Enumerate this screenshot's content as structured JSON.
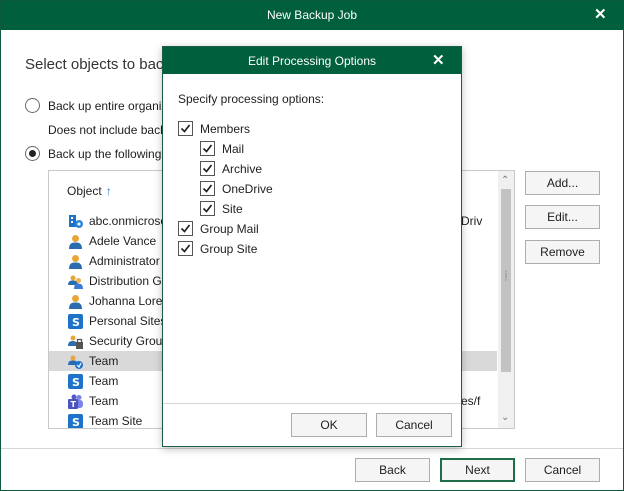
{
  "window": {
    "title": "New Backup Job"
  },
  "main": {
    "heading": "Select objects to bac",
    "radio_entire": "Back up entire organiz",
    "subnote": "Does not include back",
    "radio_following": "Back up the following",
    "column_header": "Object",
    "rows": [
      {
        "name": "abc.onmicroso",
        "right": "Driv",
        "icon": "organization-icon"
      },
      {
        "name": "Adele Vance",
        "right": "",
        "icon": "user-icon"
      },
      {
        "name": "Administrator",
        "right": "",
        "icon": "user-icon"
      },
      {
        "name": "Distribution Gr",
        "right": "",
        "icon": "group-icon"
      },
      {
        "name": "Johanna Loren",
        "right": "",
        "icon": "user-icon"
      },
      {
        "name": "Personal Sites",
        "right": "",
        "icon": "sharepoint-icon"
      },
      {
        "name": "Security Group",
        "right": "",
        "icon": "security-group-icon"
      },
      {
        "name": "Team",
        "right": "",
        "icon": "team-group-icon"
      },
      {
        "name": "Team",
        "right": "",
        "icon": "sharepoint-icon"
      },
      {
        "name": "Team",
        "right": "es/f",
        "icon": "teams-icon"
      },
      {
        "name": "Team Site",
        "right": "",
        "icon": "sharepoint-icon"
      }
    ],
    "selected_row": 7
  },
  "side_buttons": {
    "add": "Add...",
    "edit": "Edit...",
    "remove": "Remove"
  },
  "footer": {
    "back": "Back",
    "next": "Next",
    "cancel": "Cancel"
  },
  "modal": {
    "title": "Edit Processing Options",
    "prompt": "Specify processing options:",
    "options": [
      {
        "label": "Members",
        "checked": true
      },
      {
        "label": "Mail",
        "checked": true
      },
      {
        "label": "Archive",
        "checked": true
      },
      {
        "label": "OneDrive",
        "checked": true
      },
      {
        "label": "Site",
        "checked": true
      },
      {
        "label": "Group Mail",
        "checked": true
      },
      {
        "label": "Group Site",
        "checked": true
      }
    ],
    "ok": "OK",
    "cancel": "Cancel"
  },
  "colors": {
    "titlebar": "#005f3c",
    "accent_blue": "#1e73c8",
    "selected_row": "#d9d9d9"
  }
}
